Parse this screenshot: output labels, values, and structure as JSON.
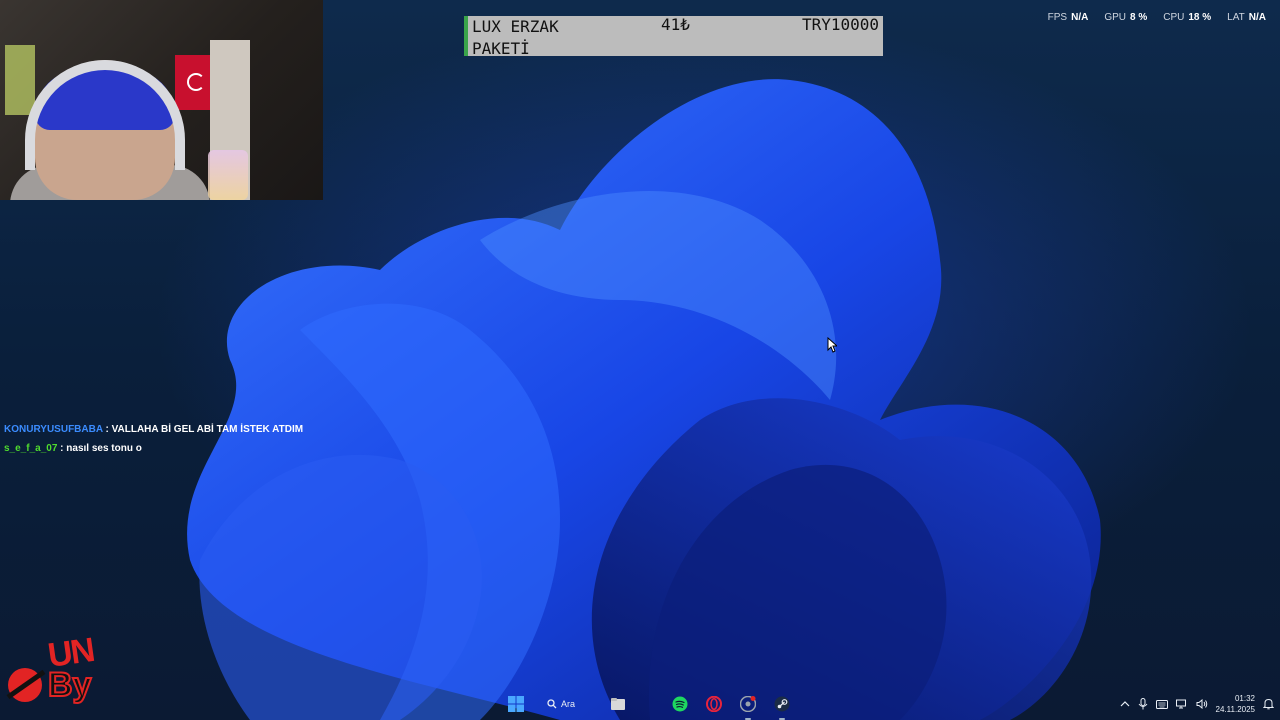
{
  "overlay": {
    "donation": {
      "name": "LUX ERZAK PAKETİ",
      "amount": "41₺",
      "currency_amount": "TRY10000"
    },
    "perf": [
      {
        "label": "FPS",
        "value": "N/A"
      },
      {
        "label": "GPU",
        "value": "8 %"
      },
      {
        "label": "CPU",
        "value": "18 %"
      },
      {
        "label": "LAT",
        "value": "N/A"
      }
    ],
    "chat": [
      {
        "user": "KONURYUSUFBABA",
        "sep": " : ",
        "text": "VALLAHA Bİ GEL ABİ TAM İSTEK ATDIM"
      },
      {
        "user": "s_e_f_a_07",
        "sep": " : ",
        "text": "nasıl ses tonu o"
      }
    ]
  },
  "taskbar": {
    "search_label": "Ara",
    "apps": [
      "start-icon",
      "search-icon",
      "file-explorer-icon",
      "spotify-icon",
      "opera-gx-icon",
      "chrome-icon",
      "steam-icon"
    ],
    "clock": {
      "time": "01:32",
      "date": "24.11.2025"
    }
  },
  "colors": {
    "chat_user_1": "#3b8cff",
    "chat_user_2": "#4fdb2e",
    "donation_bar": "#3aa44a",
    "logo_red": "#e22424"
  }
}
